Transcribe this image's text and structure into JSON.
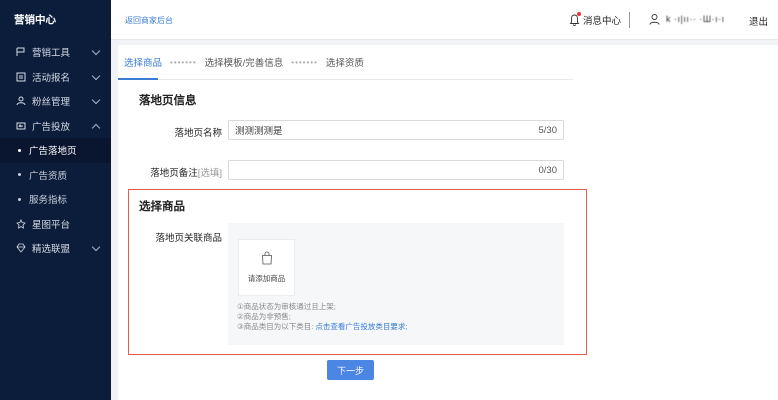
{
  "sidebar": {
    "brand": "营销中心",
    "items": [
      {
        "label": "营销工具",
        "icon": "flag-icon",
        "expandable": true
      },
      {
        "label": "活动报名",
        "icon": "calendar-icon",
        "expandable": true
      },
      {
        "label": "粉丝管理",
        "icon": "fans-icon",
        "expandable": true
      },
      {
        "label": "广告投放",
        "icon": "ad-icon",
        "expandable": true
      }
    ],
    "subitems": [
      {
        "label": "广告落地页",
        "active": true
      },
      {
        "label": "广告资质",
        "active": false
      },
      {
        "label": "服务指标",
        "active": false
      }
    ],
    "items_after": [
      {
        "label": "星图平台",
        "icon": "star-map-icon",
        "expandable": false
      },
      {
        "label": "精选联盟",
        "icon": "diamond-icon",
        "expandable": true
      }
    ]
  },
  "topbar": {
    "back_link": "返回商家后台",
    "messages": "消息中心",
    "username": "k ·ı|ıı·· ·Ш·ı·ı",
    "logout": "退出"
  },
  "steps": {
    "step1": "选择商品",
    "step2": "选择模板/完善信息",
    "step3": "选择资质",
    "separator": "•••••••"
  },
  "landing": {
    "section_title": "落地页信息",
    "name_label": "落地页名称",
    "name_value": "测测测测是",
    "name_counter": "5/30",
    "remark_label": "落地页备注",
    "remark_optional": "[选填]",
    "remark_value": "",
    "remark_counter": "0/30"
  },
  "goods": {
    "section_title": "选择商品",
    "assoc_label": "落地页关联商品",
    "add_label": "请添加商品",
    "note1": "①商品状态为审核通过且上架;",
    "note2": "②商品为非预售;",
    "note3_prefix": "③商品类目为以下类目:",
    "note3_link": "点击查看广告投放类目要求;"
  },
  "actions": {
    "next": "下一步"
  },
  "colors": {
    "sidebar_bg": "#0c1c3b",
    "accent": "#3a7bd5",
    "highlight_border": "#e45a4c",
    "button": "#4b86e4"
  }
}
